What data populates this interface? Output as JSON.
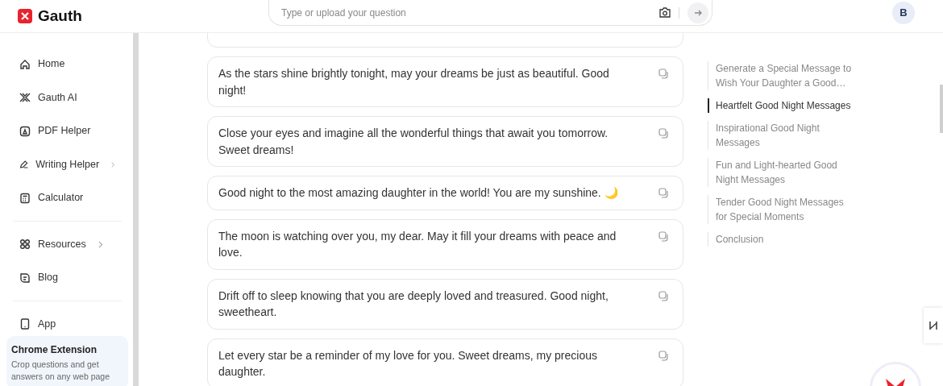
{
  "header": {
    "brand": "Gauth",
    "search": {
      "placeholder": "Type or upload your question"
    },
    "avatar": "B"
  },
  "sidebar": {
    "groups": [
      {
        "items": [
          {
            "label": "Home",
            "submenu": false
          },
          {
            "label": "Gauth AI",
            "submenu": false
          },
          {
            "label": "PDF Helper",
            "submenu": false
          },
          {
            "label": "Writing Helper",
            "submenu": true
          },
          {
            "label": "Calculator",
            "submenu": false
          }
        ]
      },
      {
        "items": [
          {
            "label": "Resources",
            "submenu": true
          },
          {
            "label": "Blog",
            "submenu": false
          }
        ]
      },
      {
        "items": [
          {
            "label": "App",
            "submenu": false
          }
        ]
      }
    ],
    "promo": {
      "title": "Chrome Extension",
      "text": "Crop questions and get answers on any web page"
    }
  },
  "messages": [
    "As the stars shine brightly tonight, may your dreams be just as beautiful. Good night!",
    "Close your eyes and imagine all the wonderful things that await you tomorrow. Sweet dreams!",
    "Good night to the most amazing daughter in the world! You are my sunshine. 🌙",
    "The moon is watching over you, my dear. May it fill your dreams with peace and love.",
    "Drift off to sleep knowing that you are deeply loved and treasured. Good night, sweetheart.",
    "Let every star be a reminder of my love for you. Sweet dreams, my precious daughter."
  ],
  "toc": [
    {
      "label": "Generate a Special Message to Wish Your Daughter a Good…",
      "selected": false
    },
    {
      "label": "Heartfelt Good Night Messages",
      "selected": true
    },
    {
      "label": "Inspirational Good Night Messages",
      "selected": false
    },
    {
      "label": "Fun and Light-hearted Good Night Messages",
      "selected": false
    },
    {
      "label": "Tender Good Night Messages for Special Moments",
      "selected": false
    },
    {
      "label": "Conclusion",
      "selected": false
    }
  ]
}
